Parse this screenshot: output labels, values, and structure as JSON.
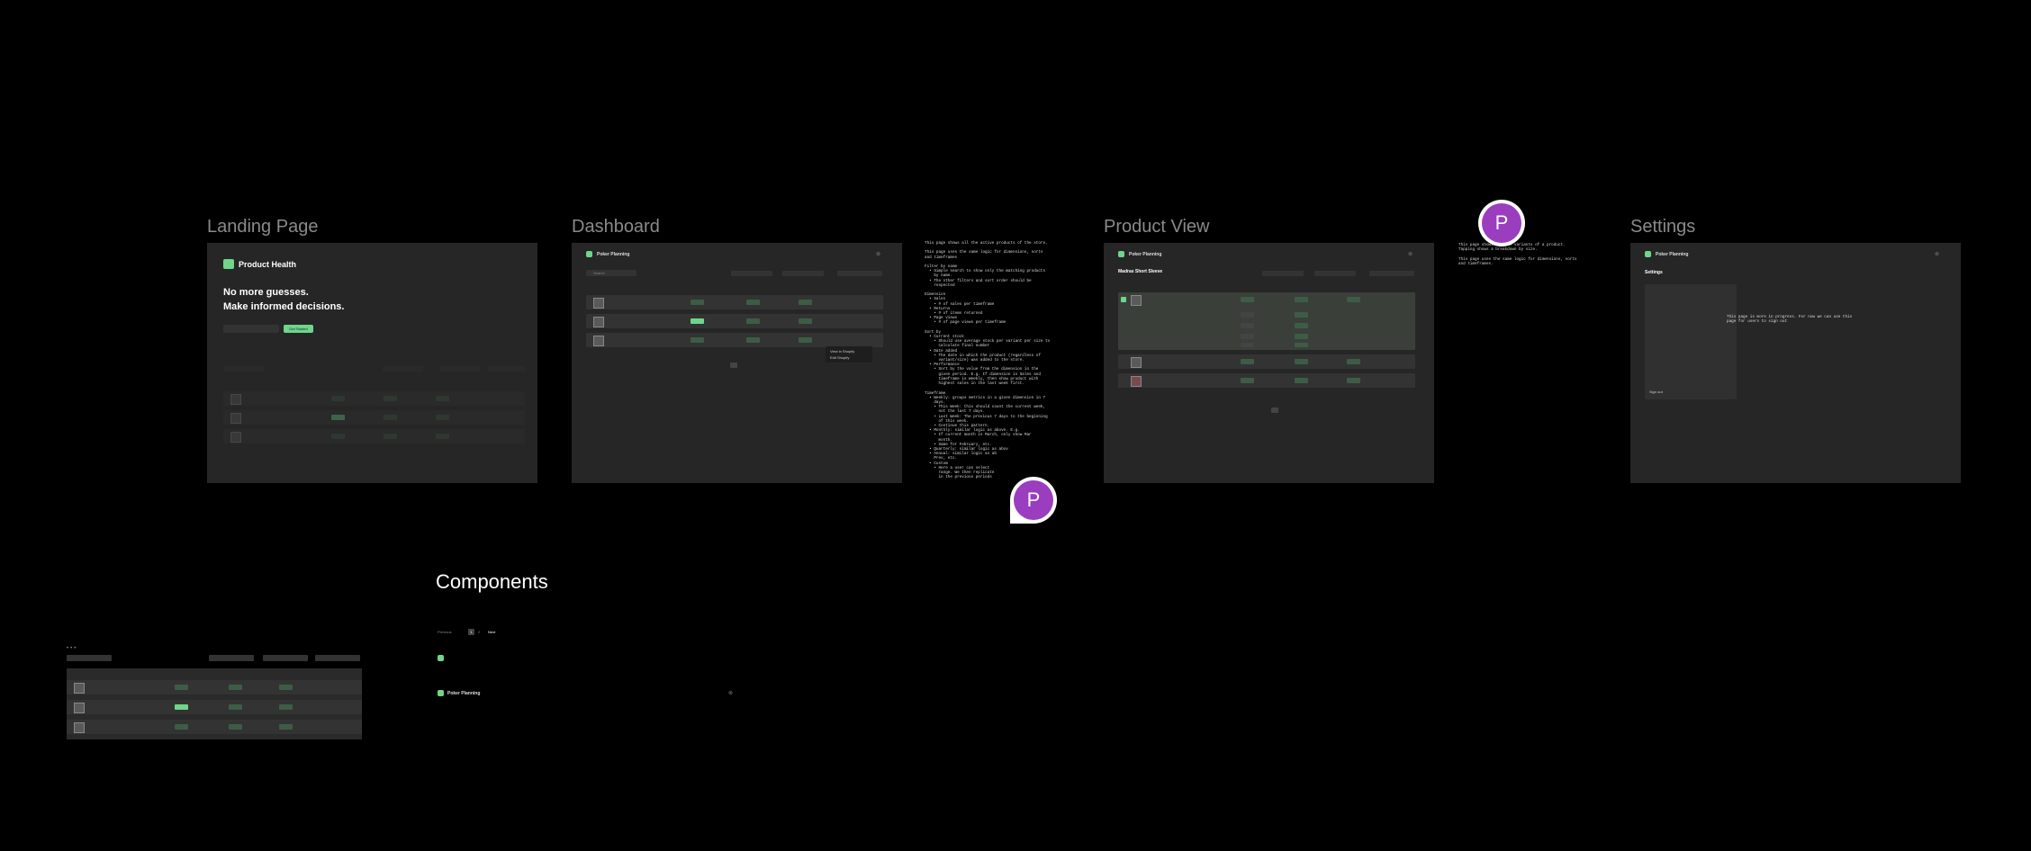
{
  "frames": {
    "landing": "Landing Page",
    "dashboard": "Dashboard",
    "product_view": "Product View",
    "settings": "Settings",
    "components": "Components"
  },
  "landing": {
    "brand": "Product Health",
    "headline_1": "No more guesses.",
    "headline_2": "Make informed decisions.",
    "cta": "Get Started"
  },
  "app": {
    "name": "Poker Planning",
    "close": "⊗"
  },
  "dashboard": {
    "search_placeholder": "Search",
    "menu_items": [
      "View in Shopify",
      "Edit Shopify"
    ]
  },
  "product_view": {
    "title": "Madras Short Sleeve"
  },
  "settings": {
    "heading": "Settings",
    "wip": "This page is more in progress. For now we can use this\npage for users to sign out",
    "sign_out": "Sign out"
  },
  "notes": {
    "dashboard": "This page shows all the active products of the store.\n\nThis page uses the same logic for dimensions, sorts\nand timeframes\n\nFilter by name\n  • Simple search to show only the matching products\n    by name.\n  • The other filters and sort order should be\n    respected\n\nDimension\n  • Sales\n    • # of sales per timeframe\n  • Returns\n    • # of items returned\n  • Page views\n    • # of page views per timeframe\n\nSort by\n  • Current stock\n    • Should use average stock per variant per size to\n      calculate final number\n  • Date added\n    • The date in which the product (regardless of\n      variant/size) was added to the store.\n  • Performance\n    • Sort by the value from the dimension in the\n      given period. E.g. If dimension is Sales and\n      timeframe is Weekly, then show product with\n      highest sales in the last week first.\n\nTimeframe\n  • Weekly: groups metrics in a given dimension in 7\n    days.\n    • This Week: this should count the current week,\n      not the last 7 days.\n    • Last Week: The previous 7 days to the beginning\n      of this week.\n    • Continue this pattern.\n  • Monthly: similar logic as above. E.g.\n    • If current month is March, only show Mar\n      month.\n    • Same for February, etc.\n  • Quarterly: similar logic as abov\n  • Annual: similar logic as ab\n    Prev, etc.\n  • Custom\n    • Here a user can select \n      range. We then replicate \n      in the previous periods",
    "product_view": "This page shows all the variants of a product.\nTapping shows a breakdown by size.\n\nThis page uses the same logic for dimensions, sorts\nand timeframes."
  },
  "components": {
    "pagination": [
      "Previous",
      "1",
      "2",
      "Next"
    ]
  },
  "cursors": [
    {
      "initial": "P",
      "color": "#9b3dbf"
    },
    {
      "initial": "P",
      "color": "#9b3dbf"
    }
  ]
}
